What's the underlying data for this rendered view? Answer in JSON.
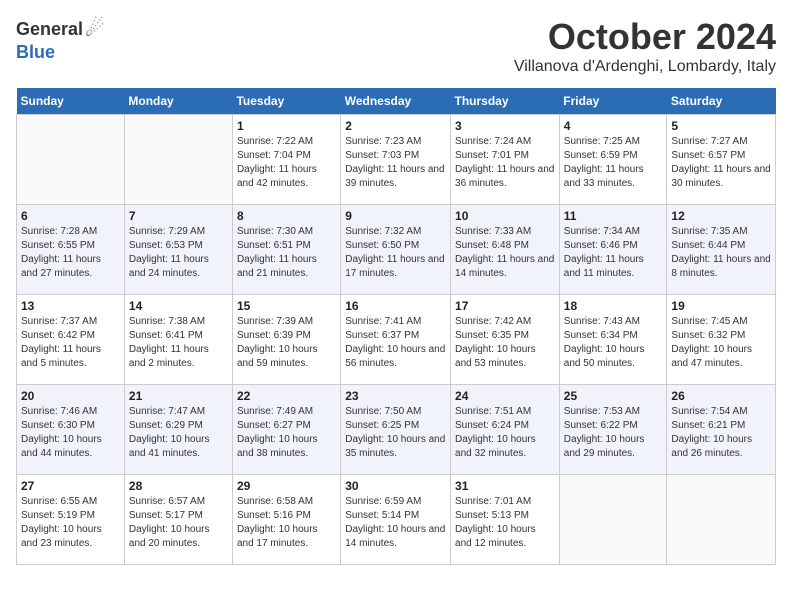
{
  "header": {
    "logo_general": "General",
    "logo_blue": "Blue",
    "month": "October 2024",
    "location": "Villanova d'Ardenghi, Lombardy, Italy"
  },
  "weekdays": [
    "Sunday",
    "Monday",
    "Tuesday",
    "Wednesday",
    "Thursday",
    "Friday",
    "Saturday"
  ],
  "weeks": [
    [
      {
        "day": "",
        "info": ""
      },
      {
        "day": "",
        "info": ""
      },
      {
        "day": "1",
        "info": "Sunrise: 7:22 AM\nSunset: 7:04 PM\nDaylight: 11 hours and 42 minutes."
      },
      {
        "day": "2",
        "info": "Sunrise: 7:23 AM\nSunset: 7:03 PM\nDaylight: 11 hours and 39 minutes."
      },
      {
        "day": "3",
        "info": "Sunrise: 7:24 AM\nSunset: 7:01 PM\nDaylight: 11 hours and 36 minutes."
      },
      {
        "day": "4",
        "info": "Sunrise: 7:25 AM\nSunset: 6:59 PM\nDaylight: 11 hours and 33 minutes."
      },
      {
        "day": "5",
        "info": "Sunrise: 7:27 AM\nSunset: 6:57 PM\nDaylight: 11 hours and 30 minutes."
      }
    ],
    [
      {
        "day": "6",
        "info": "Sunrise: 7:28 AM\nSunset: 6:55 PM\nDaylight: 11 hours and 27 minutes."
      },
      {
        "day": "7",
        "info": "Sunrise: 7:29 AM\nSunset: 6:53 PM\nDaylight: 11 hours and 24 minutes."
      },
      {
        "day": "8",
        "info": "Sunrise: 7:30 AM\nSunset: 6:51 PM\nDaylight: 11 hours and 21 minutes."
      },
      {
        "day": "9",
        "info": "Sunrise: 7:32 AM\nSunset: 6:50 PM\nDaylight: 11 hours and 17 minutes."
      },
      {
        "day": "10",
        "info": "Sunrise: 7:33 AM\nSunset: 6:48 PM\nDaylight: 11 hours and 14 minutes."
      },
      {
        "day": "11",
        "info": "Sunrise: 7:34 AM\nSunset: 6:46 PM\nDaylight: 11 hours and 11 minutes."
      },
      {
        "day": "12",
        "info": "Sunrise: 7:35 AM\nSunset: 6:44 PM\nDaylight: 11 hours and 8 minutes."
      }
    ],
    [
      {
        "day": "13",
        "info": "Sunrise: 7:37 AM\nSunset: 6:42 PM\nDaylight: 11 hours and 5 minutes."
      },
      {
        "day": "14",
        "info": "Sunrise: 7:38 AM\nSunset: 6:41 PM\nDaylight: 11 hours and 2 minutes."
      },
      {
        "day": "15",
        "info": "Sunrise: 7:39 AM\nSunset: 6:39 PM\nDaylight: 10 hours and 59 minutes."
      },
      {
        "day": "16",
        "info": "Sunrise: 7:41 AM\nSunset: 6:37 PM\nDaylight: 10 hours and 56 minutes."
      },
      {
        "day": "17",
        "info": "Sunrise: 7:42 AM\nSunset: 6:35 PM\nDaylight: 10 hours and 53 minutes."
      },
      {
        "day": "18",
        "info": "Sunrise: 7:43 AM\nSunset: 6:34 PM\nDaylight: 10 hours and 50 minutes."
      },
      {
        "day": "19",
        "info": "Sunrise: 7:45 AM\nSunset: 6:32 PM\nDaylight: 10 hours and 47 minutes."
      }
    ],
    [
      {
        "day": "20",
        "info": "Sunrise: 7:46 AM\nSunset: 6:30 PM\nDaylight: 10 hours and 44 minutes."
      },
      {
        "day": "21",
        "info": "Sunrise: 7:47 AM\nSunset: 6:29 PM\nDaylight: 10 hours and 41 minutes."
      },
      {
        "day": "22",
        "info": "Sunrise: 7:49 AM\nSunset: 6:27 PM\nDaylight: 10 hours and 38 minutes."
      },
      {
        "day": "23",
        "info": "Sunrise: 7:50 AM\nSunset: 6:25 PM\nDaylight: 10 hours and 35 minutes."
      },
      {
        "day": "24",
        "info": "Sunrise: 7:51 AM\nSunset: 6:24 PM\nDaylight: 10 hours and 32 minutes."
      },
      {
        "day": "25",
        "info": "Sunrise: 7:53 AM\nSunset: 6:22 PM\nDaylight: 10 hours and 29 minutes."
      },
      {
        "day": "26",
        "info": "Sunrise: 7:54 AM\nSunset: 6:21 PM\nDaylight: 10 hours and 26 minutes."
      }
    ],
    [
      {
        "day": "27",
        "info": "Sunrise: 6:55 AM\nSunset: 5:19 PM\nDaylight: 10 hours and 23 minutes."
      },
      {
        "day": "28",
        "info": "Sunrise: 6:57 AM\nSunset: 5:17 PM\nDaylight: 10 hours and 20 minutes."
      },
      {
        "day": "29",
        "info": "Sunrise: 6:58 AM\nSunset: 5:16 PM\nDaylight: 10 hours and 17 minutes."
      },
      {
        "day": "30",
        "info": "Sunrise: 6:59 AM\nSunset: 5:14 PM\nDaylight: 10 hours and 14 minutes."
      },
      {
        "day": "31",
        "info": "Sunrise: 7:01 AM\nSunset: 5:13 PM\nDaylight: 10 hours and 12 minutes."
      },
      {
        "day": "",
        "info": ""
      },
      {
        "day": "",
        "info": ""
      }
    ]
  ]
}
